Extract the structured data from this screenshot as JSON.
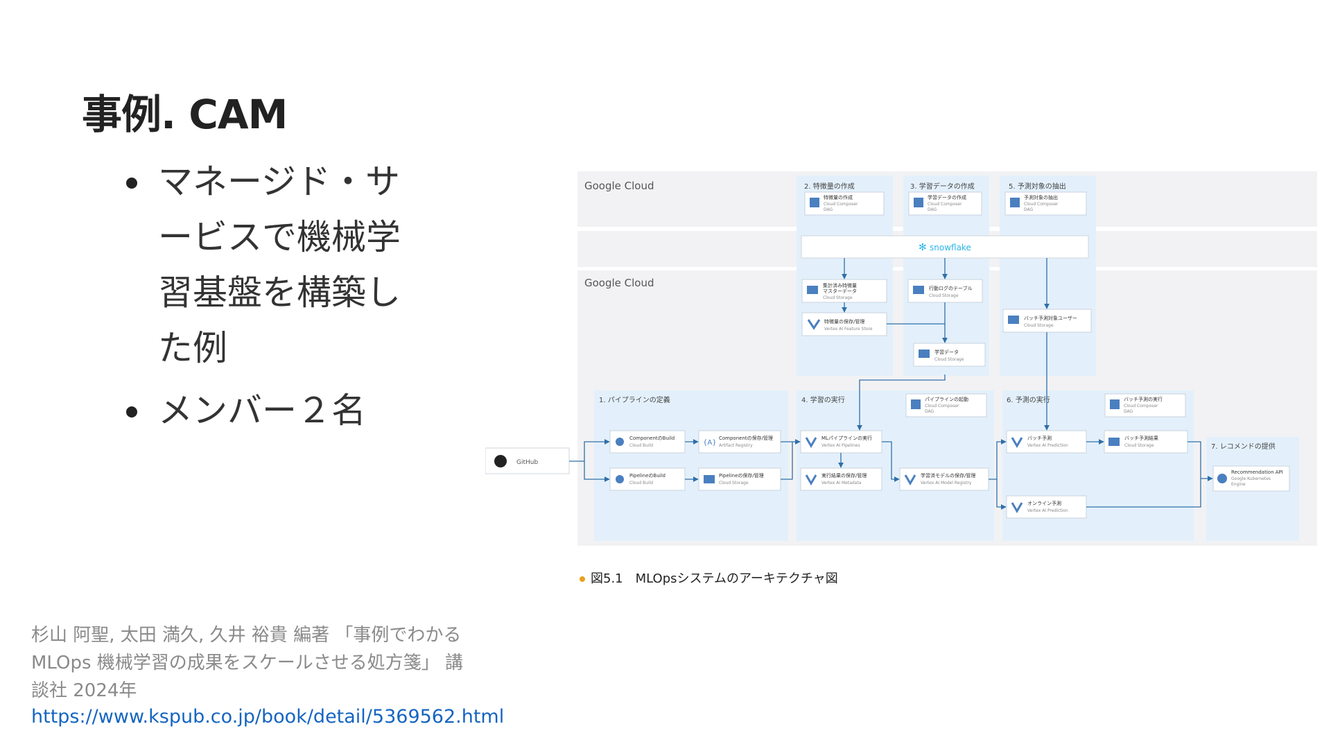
{
  "slide": {
    "title": "事例. CAM",
    "bullets": [
      "マネージド・サービスで機械学習基盤を構築した例",
      "メンバー２名"
    ]
  },
  "figure": {
    "caption": "図5.1　MLOpsシステムのアーキテクチャ図",
    "cloud_labels": [
      "Google Cloud",
      "Google Cloud"
    ],
    "snowflake_label": "snowflake",
    "github_label": "GitHub",
    "sections": {
      "s2": "2. 特徴量の作成",
      "s3": "3. 学習データの作成",
      "s5": "5. 予測対象の抽出",
      "s1": "1. パイプラインの定義",
      "s4": "4. 学習の実行",
      "s6": "6. 予測の実行",
      "s7": "7. レコメンドの提供"
    },
    "nodes": {
      "n_feat_dag": {
        "title": "特徴量の作成",
        "sub1": "Cloud Composer",
        "sub2": "DAG"
      },
      "n_train_dag": {
        "title": "学習データの作成",
        "sub1": "Cloud Composer",
        "sub2": "DAG"
      },
      "n_pred_dag": {
        "title": "予測対象の抽出",
        "sub1": "Cloud Composer",
        "sub2": "DAG"
      },
      "n_agg": {
        "title": "集計済み特徴量",
        "title2": "マスターデータ",
        "sub1": "Cloud Storage"
      },
      "n_log": {
        "title": "行動ログのテーブル",
        "sub1": "Cloud Storage"
      },
      "n_batch_users": {
        "title": "バッチ予測対象ユーザー",
        "sub1": "Cloud Storage"
      },
      "n_fstore": {
        "title": "特徴量の保存/管理",
        "sub1": "Vertex AI Feature Store"
      },
      "n_train_data": {
        "title": "学習データ",
        "sub1": "Cloud Storage"
      },
      "n_pipe_launch": {
        "title": "パイプラインの起動",
        "sub1": "Cloud Composer",
        "sub2": "DAG"
      },
      "n_batch_run": {
        "title": "バッチ予測の実行",
        "sub1": "Cloud Composer",
        "sub2": "DAG"
      },
      "n_comp_build": {
        "title": "ComponentのBuild",
        "sub1": "Cloud Build"
      },
      "n_comp_store": {
        "title": "Componentの保存/管理",
        "sub1": "Artifact Registry"
      },
      "n_pipe_build": {
        "title": "PipelineのBuild",
        "sub1": "Cloud Build"
      },
      "n_pipe_store": {
        "title": "Pipelineの保存/管理",
        "sub1": "Cloud Storage"
      },
      "n_ml_pipe": {
        "title": "MLパイプラインの実行",
        "sub1": "Vertex AI Pipelines"
      },
      "n_result": {
        "title": "実行結果の保存/管理",
        "sub1": "Vertex AI Metadata"
      },
      "n_model": {
        "title": "学習済モデルの保存/管理",
        "sub1": "Vertex AI Model Registry"
      },
      "n_batch_pred": {
        "title": "バッチ予測",
        "sub1": "Vertex AI Prediction"
      },
      "n_batch_res": {
        "title": "バッチ予測結果",
        "sub1": "Cloud Storage"
      },
      "n_online": {
        "title": "オンライン予測",
        "sub1": "Vertex AI Prediction"
      },
      "n_rec_api": {
        "title": "Recommendation API",
        "sub1": "Google Kubernetes",
        "sub2": "Engine"
      }
    }
  },
  "citation": {
    "text": "杉山 阿聖, 太田 満久, 久井 裕貴 編著 「事例でわかるMLOps 機械学習の成果をスケールさせる処方箋」 講談社 2024年",
    "url": "https://www.kspub.co.jp/book/detail/5369562.html"
  },
  "colors": {
    "section_bg": "#e3f0fb",
    "band_bg": "#f2f2f4",
    "arrow": "#2f6fa8",
    "node_icon": "#4a7fc0",
    "caption_dot": "#e8a020",
    "link": "#1565c0"
  }
}
